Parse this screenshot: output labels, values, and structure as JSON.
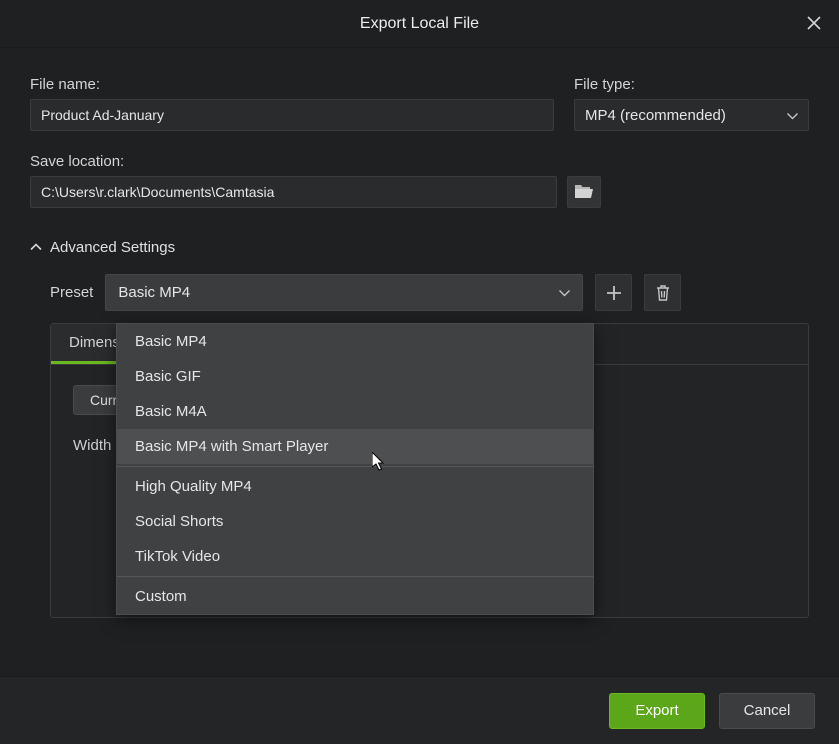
{
  "titlebar": {
    "title": "Export Local File"
  },
  "filename": {
    "label": "File name:",
    "value": "Product Ad-January"
  },
  "filetype": {
    "label": "File type:",
    "value": "MP4 (recommended)"
  },
  "savelocation": {
    "label": "Save location:",
    "value": "C:\\Users\\r.clark\\Documents\\Camtasia"
  },
  "advanced": {
    "label": "Advanced Settings"
  },
  "preset": {
    "label": "Preset",
    "selected": "Basic MP4",
    "options_group1": [
      "Basic MP4",
      "Basic GIF",
      "Basic M4A",
      "Basic MP4 with Smart Player"
    ],
    "options_group2": [
      "High Quality MP4",
      "Social Shorts",
      "TikTok Video"
    ],
    "options_group3": [
      "Custom"
    ],
    "hovered_index": 3
  },
  "panel": {
    "tabs": [
      "Dimensions"
    ],
    "active_tab": 0,
    "chip": "Current",
    "width_label": "Width"
  },
  "footer": {
    "export": "Export",
    "cancel": "Cancel"
  }
}
